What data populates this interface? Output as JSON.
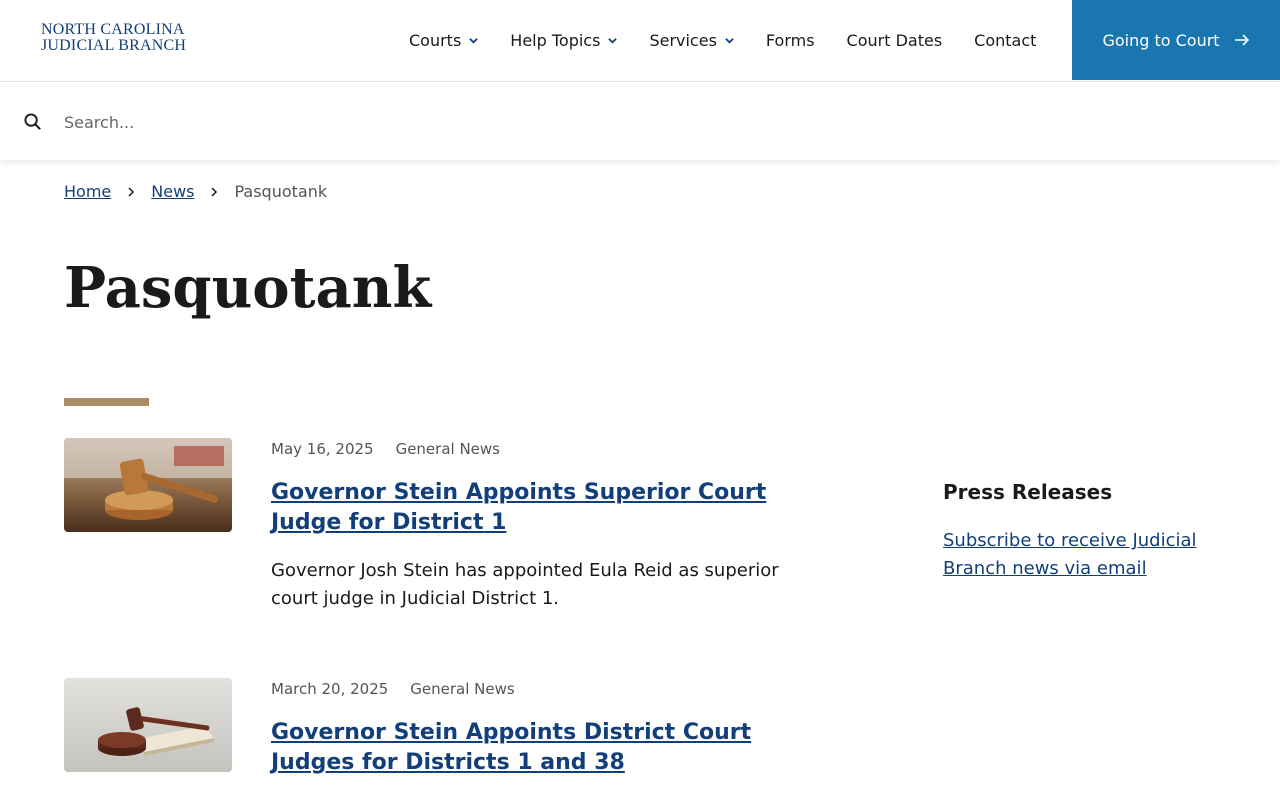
{
  "header": {
    "logo_line1": "NORTH CAROLINA",
    "logo_line2": "JUDICIAL BRANCH",
    "nav": [
      {
        "label": "Courts",
        "icon": "chevron-down-icon"
      },
      {
        "label": "Help Topics",
        "icon": "chevron-down-icon"
      },
      {
        "label": "Services",
        "icon": "chevron-down-icon"
      },
      {
        "label": "Forms"
      },
      {
        "label": "Court Dates"
      },
      {
        "label": "Contact"
      }
    ],
    "cta_label": "Going to Court",
    "cta_icon": "arrow-right-icon"
  },
  "search": {
    "icon": "search-icon",
    "placeholder": "Search..."
  },
  "breadcrumb": {
    "home": "Home",
    "news": "News",
    "current": "Pasquotank"
  },
  "page": {
    "title": "Pasquotank"
  },
  "articles": [
    {
      "date": "May 16, 2025",
      "category": "General News",
      "title": "Governor Stein Appoints Superior Court Judge for District 1",
      "summary": "Governor Josh Stein has appointed Eula Reid as superior court judge in Judicial District 1."
    },
    {
      "date": "March 20, 2025",
      "category": "General News",
      "title": "Governor Stein Appoints District Court Judges for Districts 1 and 38"
    }
  ],
  "sidebar": {
    "heading": "Press Releases",
    "subscribe_link": "Subscribe to receive Judicial Branch news via email"
  },
  "colors": {
    "brand_blue": "#1a76ae",
    "link_navy": "#123f7a",
    "accent_tan": "#a98c66"
  }
}
